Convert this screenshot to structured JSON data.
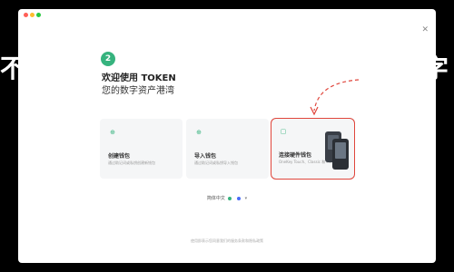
{
  "background": {
    "left_text": "不",
    "right_text": "字 夺",
    "color": "#000000"
  },
  "window": {
    "traffic_lights": {
      "red": "#ff5f57",
      "yellow": "#febc2e",
      "green": "#28c840"
    },
    "close_icon": "close-icon",
    "close_glyph": "✕"
  },
  "brand": {
    "logo_glyph": "2",
    "logo_color": "#36b37e"
  },
  "header": {
    "welcome": "欢迎使用 TOKEN",
    "subtitle": "您的数字资产港湾"
  },
  "cards": [
    {
      "title": "创建钱包",
      "desc": "通过助记词或私钥创建新钱包",
      "icon": "plus-circle-icon",
      "icon_glyph": "⊕",
      "icon_color": "#36b37e"
    },
    {
      "title": "导入钱包",
      "desc": "通过助记词或私钥导入钱包",
      "icon": "download-icon",
      "icon_glyph": "⊕",
      "icon_color": "#36b37e"
    },
    {
      "title": "连接硬件钱包",
      "desc": "OneKey Touch、Classic 和 Mini",
      "icon": "usb-icon",
      "icon_glyph": "▢",
      "icon_color": "#36b37e",
      "highlighted": true
    }
  ],
  "language": {
    "label": "简体中文",
    "chevron": "▾",
    "indicator_colors": [
      "#36b37e",
      "#4a6cf7"
    ]
  },
  "footer": {
    "text": "使用即表示您同意我们的服务条款和隐私政策"
  },
  "colors": {
    "accent": "#36b37e",
    "highlight": "#e0463c",
    "card_bg": "#f5f6f7"
  }
}
